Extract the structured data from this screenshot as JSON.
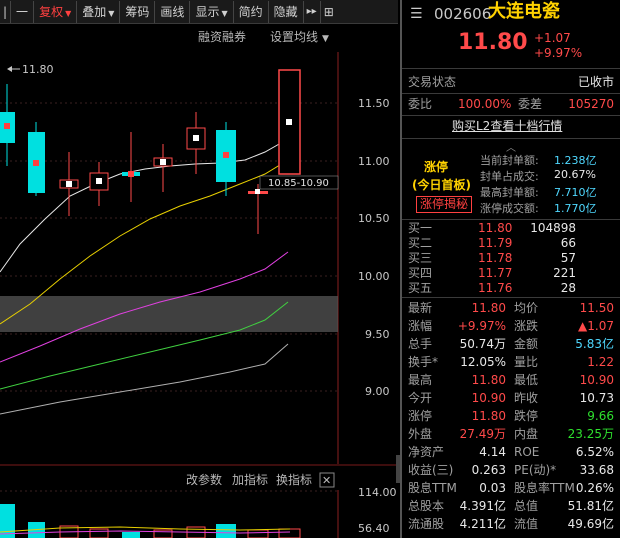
{
  "toolbar": {
    "items": [
      "|",
      "一",
      "复权",
      "叠加",
      "筹码",
      "画线",
      "显示",
      "简约",
      "隐藏",
      "▸▸",
      "⊞"
    ]
  },
  "chart": {
    "links": {
      "margin": "融资融券",
      "ma_settings": "设置均线"
    },
    "price_ticks": [
      "11.50",
      "11.00",
      "10.50",
      "10.00",
      "9.50",
      "9.00"
    ],
    "high_marker": "11.80",
    "range_tag": "10.85-10.90",
    "indicator_links": {
      "params": "改参数",
      "add": "加指标",
      "switch": "换指标"
    },
    "close_label": "✕",
    "vol_ticks": [
      "114.00",
      "56.40"
    ]
  },
  "quote": {
    "code": "002606",
    "name": "大连电瓷",
    "price": "11.80",
    "change": "+1.07",
    "change_pct": "+9.97%",
    "trade_status_label": "交易状态",
    "trade_status": "已收市",
    "wei_bi_label": "委比",
    "wei_bi": "100.00%",
    "wei_cha_label": "委差",
    "wei_cha": "105270",
    "l2_link": "购买L2查看十档行情",
    "limit_title": "涨停",
    "limit_sub": "(今日首板)",
    "limit_button": "涨停揭秘",
    "limit_rows": [
      {
        "label": "当前封单额:",
        "value": "1.238亿"
      },
      {
        "label": "封单占成交:",
        "value": "20.67%"
      },
      {
        "label": "最高封单额:",
        "value": "7.710亿"
      },
      {
        "label": "涨停成交额:",
        "value": "1.770亿"
      }
    ],
    "bids": [
      {
        "label": "买一",
        "price": "11.80",
        "vol": "104898"
      },
      {
        "label": "买二",
        "price": "11.79",
        "vol": "66"
      },
      {
        "label": "买三",
        "price": "11.78",
        "vol": "57"
      },
      {
        "label": "买四",
        "price": "11.77",
        "vol": "221"
      },
      {
        "label": "买五",
        "price": "11.76",
        "vol": "28"
      }
    ],
    "stats": [
      {
        "l1": "最新",
        "v1": "11.80",
        "c1": "red",
        "l2": "均价",
        "v2": "11.50",
        "c2": "red"
      },
      {
        "l1": "涨幅",
        "v1": "+9.97%",
        "c1": "red",
        "l2": "涨跌",
        "v2": "▲1.07",
        "c2": "red"
      },
      {
        "l1": "总手",
        "v1": "50.74万",
        "c1": "white",
        "l2": "金额",
        "v2": "5.83亿",
        "c2": "cyan"
      },
      {
        "l1": "换手*",
        "v1": "12.05%",
        "c1": "white",
        "l2": "量比",
        "v2": "1.22",
        "c2": "red"
      },
      {
        "l1": "最高",
        "v1": "11.80",
        "c1": "red",
        "l2": "最低",
        "v2": "10.90",
        "c2": "red"
      },
      {
        "l1": "今开",
        "v1": "10.90",
        "c1": "red",
        "l2": "昨收",
        "v2": "10.73",
        "c2": "white"
      },
      {
        "l1": "涨停",
        "v1": "11.80",
        "c1": "red",
        "l2": "跌停",
        "v2": "9.66",
        "c2": "green"
      },
      {
        "l1": "外盘",
        "v1": "27.49万",
        "c1": "red",
        "l2": "内盘",
        "v2": "23.25万",
        "c2": "green"
      },
      {
        "l1": "净资产",
        "v1": "4.14",
        "c1": "white",
        "l2": "ROE",
        "v2": "6.52%",
        "c2": "white"
      },
      {
        "l1": "收益(三)",
        "v1": "0.263",
        "c1": "white",
        "l2": "PE(动)*",
        "v2": "33.68",
        "c2": "white"
      },
      {
        "l1": "股息TTM",
        "v1": "0.03",
        "c1": "white",
        "l2": "股息率TTM",
        "v2": "0.26%",
        "c2": "white"
      },
      {
        "l1": "总股本",
        "v1": "4.391亿",
        "c1": "white",
        "l2": "总值",
        "v2": "51.81亿",
        "c2": "white"
      },
      {
        "l1": "流通股",
        "v1": "4.211亿",
        "c1": "white",
        "l2": "流值",
        "v2": "49.69亿",
        "c2": "white"
      }
    ]
  },
  "colors": {
    "up": "#ff4a4a",
    "down": "#00e0e0",
    "accent_red": "#ff3030"
  }
}
